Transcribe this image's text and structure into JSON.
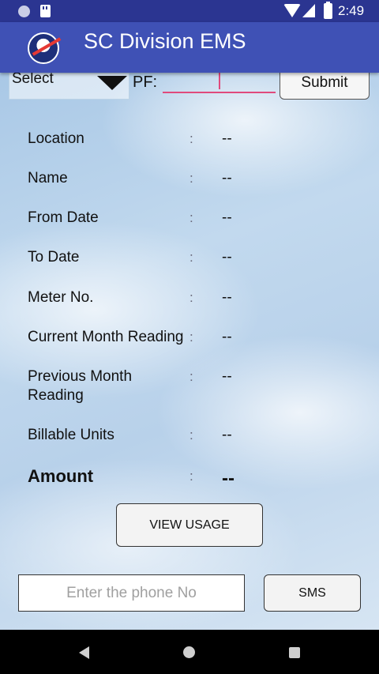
{
  "status_bar": {
    "time": "2:49"
  },
  "app_bar": {
    "title": "SC Division EMS"
  },
  "form": {
    "select_label": "Select",
    "pf_label": "PF:",
    "pf_value": "",
    "submit_label": "Submit"
  },
  "details": {
    "location": {
      "label": "Location",
      "value": "--"
    },
    "name": {
      "label": "Name",
      "value": "--"
    },
    "from_date": {
      "label": "From Date",
      "value": "--"
    },
    "to_date": {
      "label": "To Date",
      "value": "--"
    },
    "meter_no": {
      "label": "Meter No.",
      "value": "--"
    },
    "current_reading": {
      "label": "Current Month Reading",
      "value": "--"
    },
    "previous_reading": {
      "label": "Previous Month Reading",
      "value": "--"
    },
    "billable_units": {
      "label": "Billable Units",
      "value": "--"
    },
    "amount": {
      "label": "Amount",
      "value": "--"
    },
    "separator": ":"
  },
  "actions": {
    "view_usage_label": "VIEW USAGE",
    "phone_placeholder": "Enter the phone No",
    "sms_label": "SMS"
  },
  "icons": {
    "status": [
      "notification-dot-icon",
      "sd-card-icon",
      "wifi-icon",
      "cell-signal-icon",
      "battery-charging-icon"
    ],
    "nav": [
      "back-icon",
      "home-icon",
      "recents-icon"
    ]
  },
  "colors": {
    "primary": "#3f51b5",
    "primary_dark": "#2b3591",
    "accent": "#e04a7c"
  }
}
